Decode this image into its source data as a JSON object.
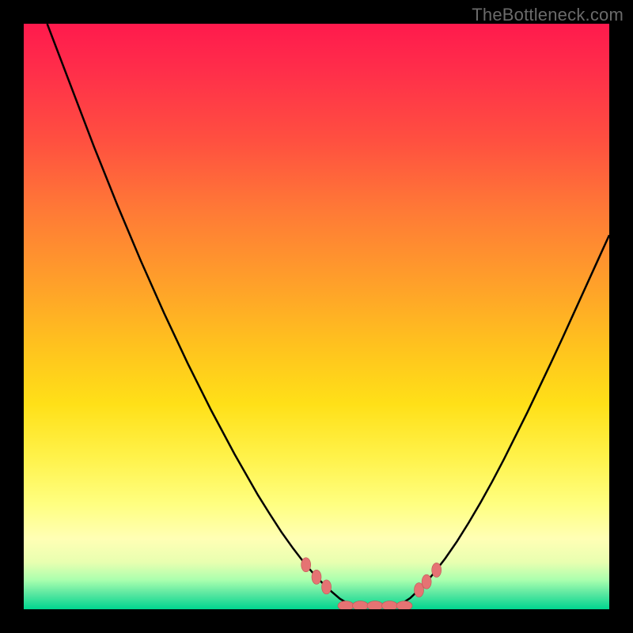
{
  "watermark": "TheBottleneck.com",
  "colors": {
    "page_bg": "#000000",
    "curve_stroke": "#000000",
    "marker_fill": "#e57373",
    "marker_stroke": "#c05555"
  },
  "chart_data": {
    "type": "line",
    "title": "",
    "xlabel": "",
    "ylabel": "",
    "xlim": [
      0,
      100
    ],
    "ylim": [
      0,
      100
    ],
    "grid": false,
    "curve1": {
      "x": [
        4,
        8,
        12,
        16,
        20,
        24,
        28,
        32,
        36,
        40,
        42,
        44,
        46,
        48,
        50,
        52,
        54,
        56
      ],
      "y": [
        100,
        89.5,
        79,
        69,
        59.5,
        50.5,
        42,
        34,
        26.5,
        19.5,
        16.3,
        13.2,
        10.4,
        7.8,
        5.5,
        3.5,
        1.8,
        0.6
      ]
    },
    "flat_bottom": {
      "x": [
        56,
        64
      ],
      "y": [
        0.6,
        0.6
      ]
    },
    "curve2": {
      "x": [
        64,
        66,
        68,
        70,
        72,
        74,
        76,
        78,
        80,
        82,
        84,
        86,
        88,
        90,
        92,
        94,
        96,
        98,
        100
      ],
      "y": [
        0.6,
        1.9,
        3.8,
        6.1,
        8.7,
        11.6,
        14.8,
        18.2,
        21.8,
        25.6,
        29.6,
        33.6,
        37.8,
        42.0,
        46.3,
        50.7,
        55.1,
        59.5,
        63.9
      ]
    },
    "markers_flat": {
      "x": [
        55,
        57.5,
        60,
        62.5,
        65
      ],
      "y": [
        0.6,
        0.6,
        0.6,
        0.6,
        0.6
      ]
    },
    "markers_left_branch": [
      {
        "x": 48.2,
        "y": 7.6
      },
      {
        "x": 50.0,
        "y": 5.5
      },
      {
        "x": 51.7,
        "y": 3.8
      }
    ],
    "markers_right_branch": [
      {
        "x": 67.5,
        "y": 3.3
      },
      {
        "x": 68.8,
        "y": 4.7
      },
      {
        "x": 70.5,
        "y": 6.7
      }
    ]
  }
}
